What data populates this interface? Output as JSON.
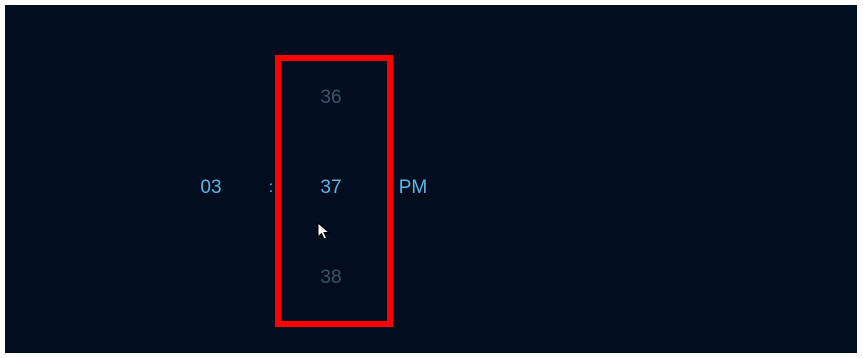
{
  "time_picker": {
    "hour": "03",
    "separator": ":",
    "minute_prev": "36",
    "minute_selected": "37",
    "minute_next": "38",
    "period": "PM"
  },
  "colors": {
    "background": "#020e20",
    "selected_text": "#5bb7e6",
    "dim_text": "#3e5267",
    "highlight_border": "#ff0000"
  },
  "icons": {
    "cursor": "mouse-pointer-icon"
  }
}
